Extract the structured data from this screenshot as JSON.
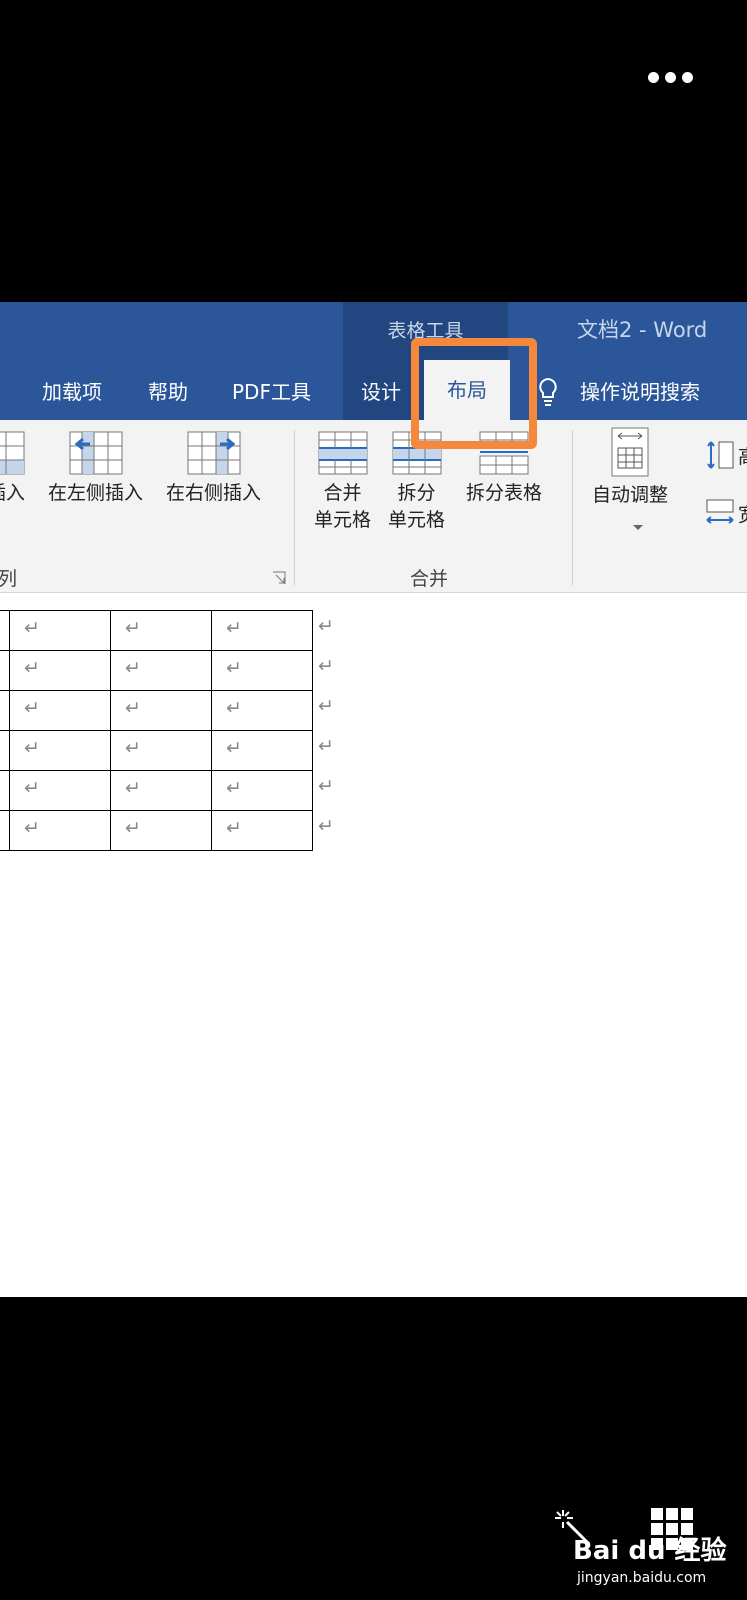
{
  "top": {
    "more_icon": "ellipsis-icon"
  },
  "word": {
    "context_title": "表格工具",
    "doc_title": "文档2 - Word",
    "tabs": [
      {
        "label": "加载项"
      },
      {
        "label": "帮助"
      },
      {
        "label": "PDF工具"
      },
      {
        "label": "设计"
      },
      {
        "label": "布局"
      }
    ],
    "search_label": "操作说明搜索",
    "ribbon": {
      "rows_cols": {
        "insert_below_label": "插入",
        "insert_left_label": "在左侧插入",
        "insert_right_label": "在右侧插入",
        "group_label": "列"
      },
      "merge": {
        "merge_cells_line1": "合并",
        "merge_cells_line2": "单元格",
        "split_cells_line1": "拆分",
        "split_cells_line2": "单元格",
        "split_table_label": "拆分表格",
        "group_label": "合并"
      },
      "cell_size": {
        "autofit_label": "自动调整",
        "height_label": "高",
        "width_label": "宽"
      }
    },
    "table": {
      "rows": 6,
      "cell_mark": "↵"
    }
  },
  "watermark": {
    "brand": "Bai du 经验",
    "url": "jingyan.baidu.com"
  },
  "colors": {
    "ribbon_blue": "#2b579a",
    "context_blue": "#224680",
    "highlight_orange": "#f5883a"
  }
}
